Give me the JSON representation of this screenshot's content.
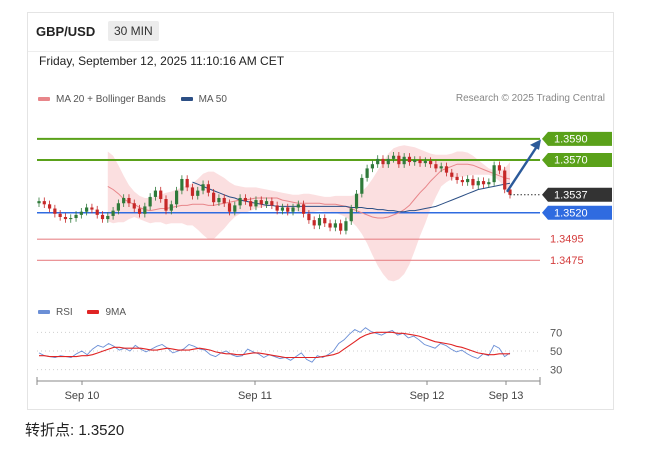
{
  "header": {
    "symbol": "GBP/USD",
    "timeframe": "30 MIN"
  },
  "timestamp": "Friday, September 12, 2025 11:10:16 AM CET",
  "legend": {
    "ma20_label": "MA 20 + Bollinger Bands",
    "ma50_label": "MA 50",
    "ma20_color": "#e8868a",
    "ma50_color": "#2c4f85"
  },
  "attribution": "Research © 2025 Trading Central",
  "rsi_legend": {
    "rsi_label": "RSI",
    "ma_label": "9MA",
    "rsi_color": "#6b8fd6",
    "ma_color": "#e02424"
  },
  "pivot_text": "转折点: 1.3520",
  "colors": {
    "resistance": "#5aa11a",
    "pivot": "#2f6be0",
    "support": "#e8868a",
    "support_text": "#d43c3c",
    "current": "#333333",
    "arrow": "#2b5a9a",
    "candle_up": "#2f7a3a",
    "candle_down": "#c62828"
  },
  "chart_data": [
    {
      "type": "candlestick",
      "title": "GBP/USD",
      "x_ticks": [
        "Sep 10",
        "Sep 11",
        "Sep 12",
        "Sep 13"
      ],
      "price_range": [
        1.3462,
        1.3605
      ],
      "levels": [
        {
          "label": "1.3590",
          "value": 1.359,
          "kind": "resistance"
        },
        {
          "label": "1.3570",
          "value": 1.357,
          "kind": "resistance"
        },
        {
          "label": "1.3537",
          "value": 1.3537,
          "kind": "current"
        },
        {
          "label": "1.3520",
          "value": 1.352,
          "kind": "pivot"
        },
        {
          "label": "1.3495",
          "value": 1.3495,
          "kind": "support"
        },
        {
          "label": "1.3475",
          "value": 1.3475,
          "kind": "support"
        }
      ],
      "close": [
        1.3531,
        1.3528,
        1.3524,
        1.3519,
        1.3516,
        1.3514,
        1.3515,
        1.3518,
        1.3521,
        1.3525,
        1.3523,
        1.3518,
        1.3514,
        1.3517,
        1.3522,
        1.3529,
        1.3534,
        1.3529,
        1.3524,
        1.3519,
        1.3526,
        1.3535,
        1.3541,
        1.3533,
        1.3522,
        1.3528,
        1.3541,
        1.3552,
        1.3544,
        1.3536,
        1.3541,
        1.3547,
        1.3539,
        1.353,
        1.3534,
        1.3529,
        1.3521,
        1.3527,
        1.3534,
        1.3531,
        1.3526,
        1.3532,
        1.3528,
        1.3531,
        1.3527,
        1.3522,
        1.3525,
        1.3521,
        1.3525,
        1.3528,
        1.3519,
        1.3513,
        1.3508,
        1.3515,
        1.351,
        1.3506,
        1.351,
        1.3503,
        1.3512,
        1.3524,
        1.3538,
        1.3553,
        1.3562,
        1.3566,
        1.3571,
        1.3566,
        1.3571,
        1.3574,
        1.3566,
        1.3573,
        1.3568,
        1.357,
        1.3567,
        1.3569,
        1.3566,
        1.3562,
        1.3564,
        1.3558,
        1.3554,
        1.3551,
        1.3549,
        1.3552,
        1.3546,
        1.355,
        1.3547,
        1.3549,
        1.3565,
        1.356,
        1.3542,
        1.3537
      ],
      "ma20": [
        1.3545,
        1.3542,
        1.3538,
        1.3533,
        1.353,
        1.3528,
        1.3525,
        1.3523,
        1.3522,
        1.3523,
        1.3524,
        1.3524,
        1.3525,
        1.3526,
        1.3527,
        1.3527,
        1.3528,
        1.3528,
        1.3528,
        1.3527,
        1.3527,
        1.3528,
        1.3529,
        1.353,
        1.3531,
        1.3532,
        1.3532,
        1.3533,
        1.3534,
        1.3534,
        1.3534,
        1.3534,
        1.3534,
        1.3532,
        1.3531,
        1.353,
        1.3529,
        1.3529,
        1.3529,
        1.3529,
        1.3529,
        1.3528,
        1.3528,
        1.3528,
        1.3527,
        1.3526,
        1.3524,
        1.3522,
        1.352,
        1.3518,
        1.3516,
        1.3515,
        1.3515,
        1.3516,
        1.3518,
        1.352,
        1.3523,
        1.3527,
        1.3533,
        1.3539,
        1.3544,
        1.355,
        1.3555,
        1.356,
        1.3562,
        1.3564,
        1.3566,
        1.3566,
        1.3566,
        1.3565,
        1.3563,
        1.3561,
        1.3559,
        1.3557,
        1.3555,
        1.3553,
        1.3552
      ],
      "ma20_upper": [
        1.3578,
        1.3574,
        1.3565,
        1.3555,
        1.3546,
        1.354,
        1.3536,
        1.3534,
        1.3534,
        1.3535,
        1.3537,
        1.3539,
        1.354,
        1.3542,
        1.3544,
        1.3546,
        1.3548,
        1.3552,
        1.3557,
        1.3559,
        1.3559,
        1.3556,
        1.3553,
        1.3549,
        1.3546,
        1.3545,
        1.3544,
        1.3544,
        1.3544,
        1.3543,
        1.3542,
        1.3541,
        1.354,
        1.3539,
        1.3538,
        1.3537,
        1.3537,
        1.3538,
        1.3538,
        1.3537,
        1.3536,
        1.3535,
        1.3535,
        1.3536,
        1.3536,
        1.3536,
        1.3536,
        1.3537,
        1.354,
        1.3545,
        1.3552,
        1.356,
        1.3568,
        1.3576,
        1.3581,
        1.3583,
        1.3584,
        1.3583,
        1.3582,
        1.358,
        1.3578,
        1.3576,
        1.3575,
        1.3575,
        1.3575,
        1.3576,
        1.3578,
        1.3578,
        1.3577,
        1.3574,
        1.357,
        1.3566,
        1.3562,
        1.356,
        1.356,
        1.3562,
        1.3568
      ],
      "ma20_lower": [
        1.3512,
        1.351,
        1.3511,
        1.3511,
        1.3514,
        1.3516,
        1.3514,
        1.3512,
        1.351,
        1.3511,
        1.3511,
        1.3509,
        1.351,
        1.351,
        1.351,
        1.3508,
        1.3508,
        1.3504,
        1.3499,
        1.3495,
        1.3495,
        1.35,
        1.3505,
        1.3511,
        1.3516,
        1.3519,
        1.352,
        1.3522,
        1.3524,
        1.3525,
        1.3526,
        1.3527,
        1.3528,
        1.3525,
        1.3524,
        1.3523,
        1.3521,
        1.352,
        1.352,
        1.3521,
        1.3522,
        1.3521,
        1.3521,
        1.352,
        1.3518,
        1.3516,
        1.3512,
        1.3507,
        1.35,
        1.3491,
        1.348,
        1.347,
        1.3462,
        1.3456,
        1.3455,
        1.3457,
        1.3462,
        1.3471,
        1.3484,
        1.3498,
        1.351,
        1.3524,
        1.3535,
        1.3545,
        1.3549,
        1.3552,
        1.3554,
        1.3554,
        1.3555,
        1.3556,
        1.3556,
        1.3556,
        1.3556,
        1.3554,
        1.355,
        1.3544,
        1.3536
      ],
      "ma50": [
        1.3549,
        1.3547,
        1.3545,
        1.3543,
        1.3541,
        1.3539,
        1.3537,
        1.3535,
        1.3534,
        1.3532,
        1.3531,
        1.353,
        1.3529,
        1.3528,
        1.3527,
        1.3527,
        1.3526,
        1.3526,
        1.3526,
        1.3526,
        1.3526,
        1.3526,
        1.3526,
        1.3526,
        1.3526,
        1.3526,
        1.3526,
        1.3526,
        1.3526,
        1.3526,
        1.3525,
        1.3525,
        1.3525,
        1.3524,
        1.3524,
        1.3523,
        1.3523,
        1.3522,
        1.3522,
        1.3521,
        1.3521,
        1.3522,
        1.3522,
        1.3523,
        1.3524,
        1.3525,
        1.3526,
        1.3528,
        1.353,
        1.3532,
        1.3534,
        1.3536,
        1.3538,
        1.354,
        1.3542,
        1.3543,
        1.3544,
        1.3545,
        1.3546,
        1.3547,
        1.3548
      ],
      "rsi_ticks": [
        70,
        50,
        30
      ],
      "rsi_range": [
        20,
        80
      ],
      "rsi": [
        48,
        45,
        44,
        43,
        45,
        44,
        43,
        47,
        50,
        46,
        52,
        56,
        54,
        58,
        55,
        51,
        53,
        50,
        56,
        52,
        49,
        52,
        55,
        57,
        53,
        48,
        50,
        52,
        57,
        55,
        52,
        51,
        46,
        44,
        48,
        50,
        46,
        44,
        45,
        52,
        49,
        47,
        43,
        46,
        44,
        42,
        43,
        40,
        44,
        48,
        41,
        38,
        45,
        43,
        46,
        50,
        58,
        62,
        68,
        73,
        70,
        75,
        71,
        69,
        67,
        70,
        72,
        67,
        69,
        64,
        66,
        62,
        57,
        55,
        53,
        58,
        56,
        52,
        49,
        51,
        47,
        44,
        42,
        47,
        45,
        56,
        53,
        44,
        48
      ],
      "rsi_ma": [
        45,
        45,
        44,
        44,
        44,
        44,
        44,
        44,
        45,
        45,
        46,
        48,
        50,
        52,
        54,
        54,
        53,
        53,
        53,
        53,
        52,
        51,
        51,
        52,
        53,
        52,
        51,
        51,
        51,
        52,
        53,
        52,
        51,
        49,
        48,
        47,
        47,
        46,
        46,
        47,
        48,
        48,
        47,
        46,
        45,
        44,
        43,
        43,
        43,
        43,
        43,
        43,
        43,
        44,
        45,
        46,
        48,
        52,
        56,
        60,
        64,
        67,
        69,
        70,
        70,
        70,
        70,
        69,
        69,
        68,
        67,
        66,
        64,
        62,
        60,
        59,
        58,
        57,
        55,
        54,
        52,
        50,
        48,
        47,
        46,
        46,
        47,
        47,
        47
      ]
    }
  ]
}
